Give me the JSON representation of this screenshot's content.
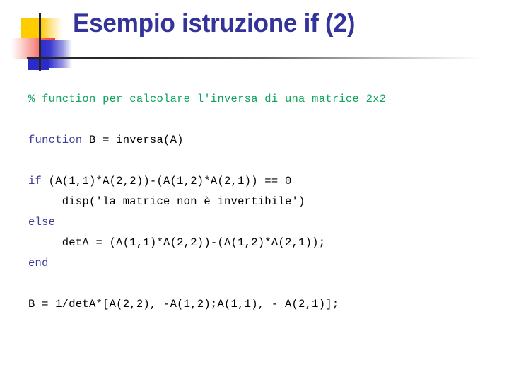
{
  "slide": {
    "title": "Esempio istruzione if (2)",
    "title_color": "#333399",
    "background_color": "#ffffff"
  },
  "decoration": {
    "name": "powerpoint-corner-motif",
    "yellow_color": "#FFCC00",
    "red_color": "#F04038",
    "blue_color": "#2B2BC8",
    "rule_color": "#232323"
  },
  "code": {
    "language": "matlab",
    "colors": {
      "comment": "#0FA35C",
      "keyword": "#3B3B99",
      "text": "#000000"
    },
    "lines": [
      {
        "id": "comment",
        "segments": [
          {
            "text": "% function per calcolare l'inversa di una matrice 2x2",
            "style": "comment"
          }
        ]
      },
      {
        "id": "signature",
        "segments": [
          {
            "text": "function",
            "style": "keyword"
          },
          {
            "text": " B = inversa(A)",
            "style": "text"
          }
        ]
      },
      {
        "id": "if",
        "segments": [
          {
            "text": "if",
            "style": "keyword"
          },
          {
            "text": " (A(1,1)*A(2,2))-(A(1,2)*A(2,1)) == 0",
            "style": "text"
          }
        ]
      },
      {
        "id": "disp",
        "segments": [
          {
            "text": "     disp('la matrice non è invertibile')",
            "style": "text"
          }
        ]
      },
      {
        "id": "else",
        "segments": [
          {
            "text": "else",
            "style": "keyword"
          }
        ]
      },
      {
        "id": "deta",
        "segments": [
          {
            "text": "     detA = (A(1,1)*A(2,2))-(A(1,2)*A(2,1));",
            "style": "text"
          }
        ]
      },
      {
        "id": "end",
        "segments": [
          {
            "text": "end",
            "style": "keyword"
          }
        ]
      },
      {
        "id": "result",
        "segments": [
          {
            "text": "B = 1/detA*[A(2,2), -A(1,2);A(1,1), - A(2,1)];",
            "style": "text"
          }
        ]
      }
    ]
  }
}
